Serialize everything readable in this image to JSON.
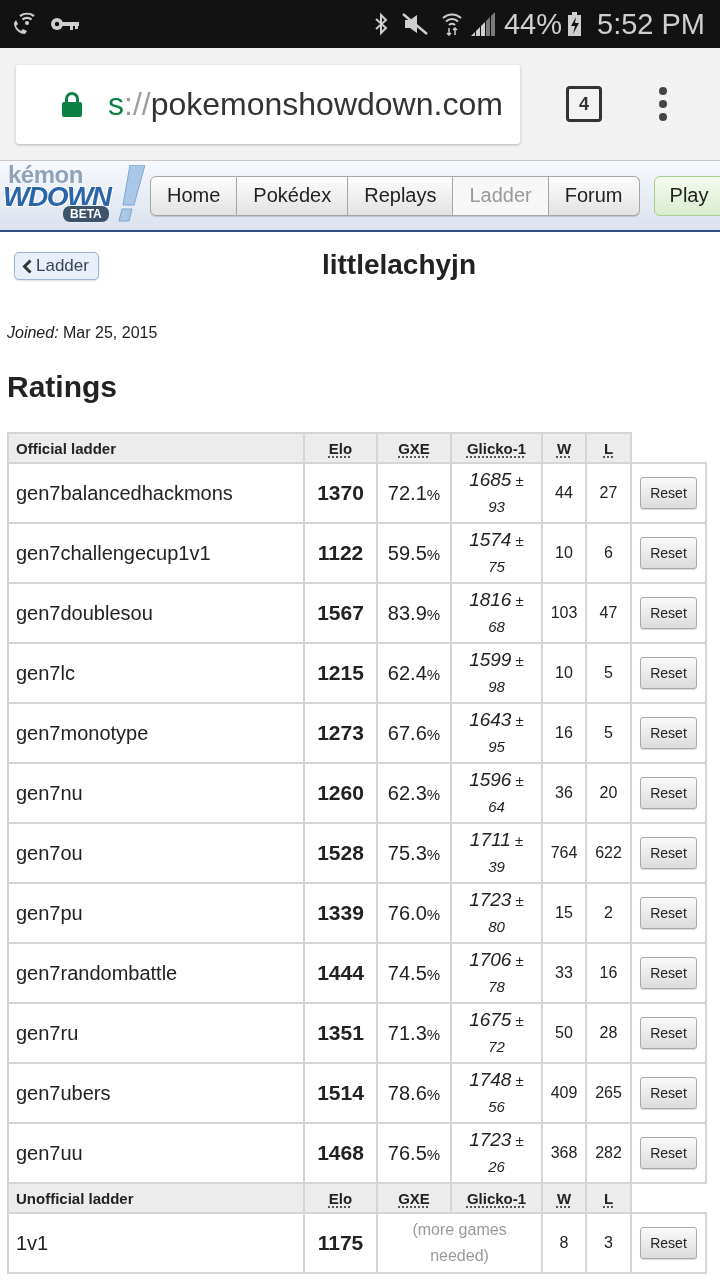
{
  "status_bar": {
    "battery": "44%",
    "time": "5:52 PM"
  },
  "browser": {
    "url": {
      "scheme": "s",
      "separator": "://",
      "host": "pokemonshowdown.com"
    },
    "tab_count": "4"
  },
  "logo": {
    "lines": [
      "kémon",
      "WDOWN"
    ],
    "badge": "BETA"
  },
  "nav": {
    "tabs": [
      {
        "label": "Home",
        "selected": false
      },
      {
        "label": "Pokédex",
        "selected": false
      },
      {
        "label": "Replays",
        "selected": false
      },
      {
        "label": "Ladder",
        "selected": true
      },
      {
        "label": "Forum",
        "selected": false
      }
    ],
    "play_button": "Play"
  },
  "back_button": "Ladder",
  "title": "littlelachyjn",
  "joined": "*Joined:* Mar 25, 2015",
  "section_title": "Ratings",
  "ladders": [
    {
      "columns": [
        "Official ladder",
        "Elo",
        "GXE",
        "Glicko-1",
        "W",
        "L"
      ],
      "rows": [
        {
          "kind": "rated",
          "format": "gen7balancedhackmons",
          "elo": "1370",
          "gxe": "72.1",
          "gxe_unit": "%",
          "glicko": "1685",
          "glicko_deviation": "± 93",
          "w": "44",
          "l": "27",
          "action": "Reset"
        },
        {
          "kind": "rated",
          "format": "gen7challengecup1v1",
          "elo": "1122",
          "gxe": "59.5",
          "gxe_unit": "%",
          "glicko": "1574",
          "glicko_deviation": "± 75",
          "w": "10",
          "l": "6",
          "action": "Reset"
        },
        {
          "kind": "rated",
          "format": "gen7doublesou",
          "elo": "1567",
          "gxe": "83.9",
          "gxe_unit": "%",
          "glicko": "1816",
          "glicko_deviation": "± 68",
          "w": "103",
          "l": "47",
          "action": "Reset"
        },
        {
          "kind": "rated",
          "format": "gen7lc",
          "elo": "1215",
          "gxe": "62.4",
          "gxe_unit": "%",
          "glicko": "1599",
          "glicko_deviation": "± 98",
          "w": "10",
          "l": "5",
          "action": "Reset"
        },
        {
          "kind": "rated",
          "format": "gen7monotype",
          "elo": "1273",
          "gxe": "67.6",
          "gxe_unit": "%",
          "glicko": "1643",
          "glicko_deviation": "± 95",
          "w": "16",
          "l": "5",
          "action": "Reset"
        },
        {
          "kind": "rated",
          "format": "gen7nu",
          "elo": "1260",
          "gxe": "62.3",
          "gxe_unit": "%",
          "glicko": "1596",
          "glicko_deviation": "± 64",
          "w": "36",
          "l": "20",
          "action": "Reset"
        },
        {
          "kind": "rated",
          "format": "gen7ou",
          "elo": "1528",
          "gxe": "75.3",
          "gxe_unit": "%",
          "glicko": "1711",
          "glicko_deviation": "± 39",
          "w": "764",
          "l": "622",
          "action": "Reset"
        },
        {
          "kind": "rated",
          "format": "gen7pu",
          "elo": "1339",
          "gxe": "76.0",
          "gxe_unit": "%",
          "glicko": "1723",
          "glicko_deviation": "± 80",
          "w": "15",
          "l": "2",
          "action": "Reset"
        },
        {
          "kind": "rated",
          "format": "gen7randombattle",
          "elo": "1444",
          "gxe": "74.5",
          "gxe_unit": "%",
          "glicko": "1706",
          "glicko_deviation": "± 78",
          "w": "33",
          "l": "16",
          "action": "Reset"
        },
        {
          "kind": "rated",
          "format": "gen7ru",
          "elo": "1351",
          "gxe": "71.3",
          "gxe_unit": "%",
          "glicko": "1675",
          "glicko_deviation": "± 72",
          "w": "50",
          "l": "28",
          "action": "Reset"
        },
        {
          "kind": "rated",
          "format": "gen7ubers",
          "elo": "1514",
          "gxe": "78.6",
          "gxe_unit": "%",
          "glicko": "1748",
          "glicko_deviation": "± 56",
          "w": "409",
          "l": "265",
          "action": "Reset"
        },
        {
          "kind": "rated",
          "format": "gen7uu",
          "elo": "1468",
          "gxe": "76.5",
          "gxe_unit": "%",
          "glicko": "1723",
          "glicko_deviation": "± 26",
          "w": "368",
          "l": "282",
          "action": "Reset"
        }
      ]
    },
    {
      "columns": [
        "Unofficial ladder",
        "Elo",
        "GXE",
        "Glicko-1",
        "W",
        "L"
      ],
      "rows": [
        {
          "kind": "provisional",
          "format": "1v1",
          "elo": "1175",
          "note": "(more games needed)",
          "w": "8",
          "l": "3",
          "action": "Reset"
        }
      ]
    }
  ]
}
